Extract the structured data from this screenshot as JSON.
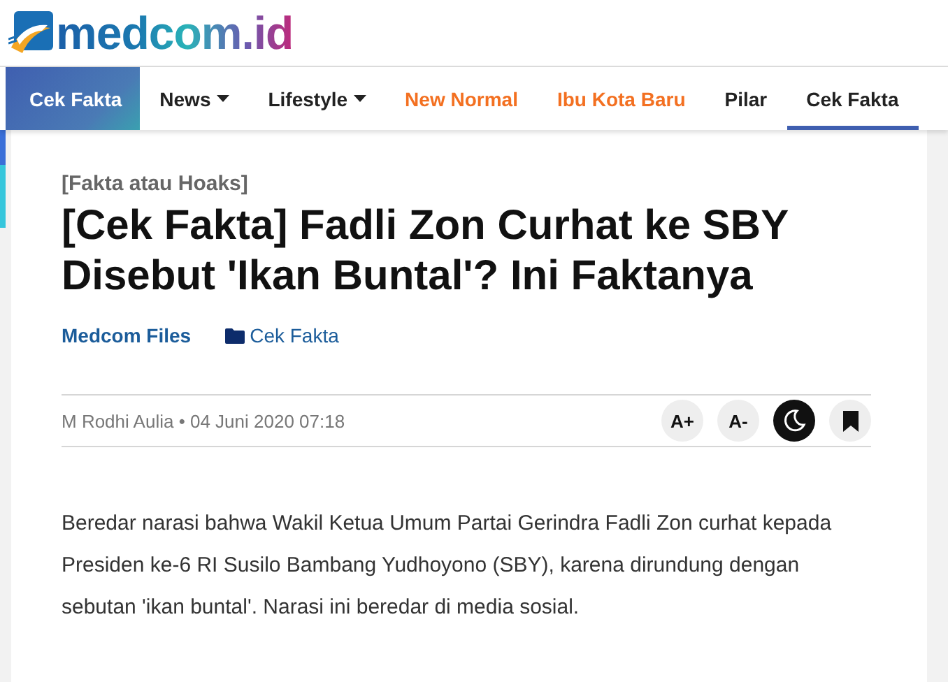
{
  "brand": {
    "name": "medcom.id"
  },
  "nav": {
    "section_label": "Cek Fakta",
    "items": [
      {
        "label": "News",
        "dropdown": true,
        "highlight": false,
        "selected": false
      },
      {
        "label": "Lifestyle",
        "dropdown": true,
        "highlight": false,
        "selected": false
      },
      {
        "label": "New Normal",
        "dropdown": false,
        "highlight": true,
        "selected": false
      },
      {
        "label": "Ibu Kota Baru",
        "dropdown": false,
        "highlight": true,
        "selected": false
      },
      {
        "label": "Pilar",
        "dropdown": false,
        "highlight": false,
        "selected": false
      },
      {
        "label": "Cek Fakta",
        "dropdown": false,
        "highlight": false,
        "selected": true
      }
    ]
  },
  "article": {
    "kicker": "[Fakta atau Hoaks]",
    "title": "[Cek Fakta] Fadli Zon Curhat ke SBY Disebut 'Ikan Buntal'? Ini Faktanya",
    "source": "Medcom Files",
    "category": "Cek Fakta",
    "byline": "M Rodhi Aulia • 04 Juni 2020 07:18",
    "tools": [
      {
        "kind": "text",
        "label": "A+"
      },
      {
        "kind": "text",
        "label": "A-"
      },
      {
        "kind": "moon"
      },
      {
        "kind": "bookmark"
      }
    ],
    "body": "Beredar narasi bahwa Wakil Ketua Umum Partai Gerindra Fadli Zon curhat kepada Presiden ke-6 RI Susilo Bambang Yudhoyono (SBY), karena dirundung dengan sebutan 'ikan buntal'. Narasi ini beredar di media sosial."
  }
}
